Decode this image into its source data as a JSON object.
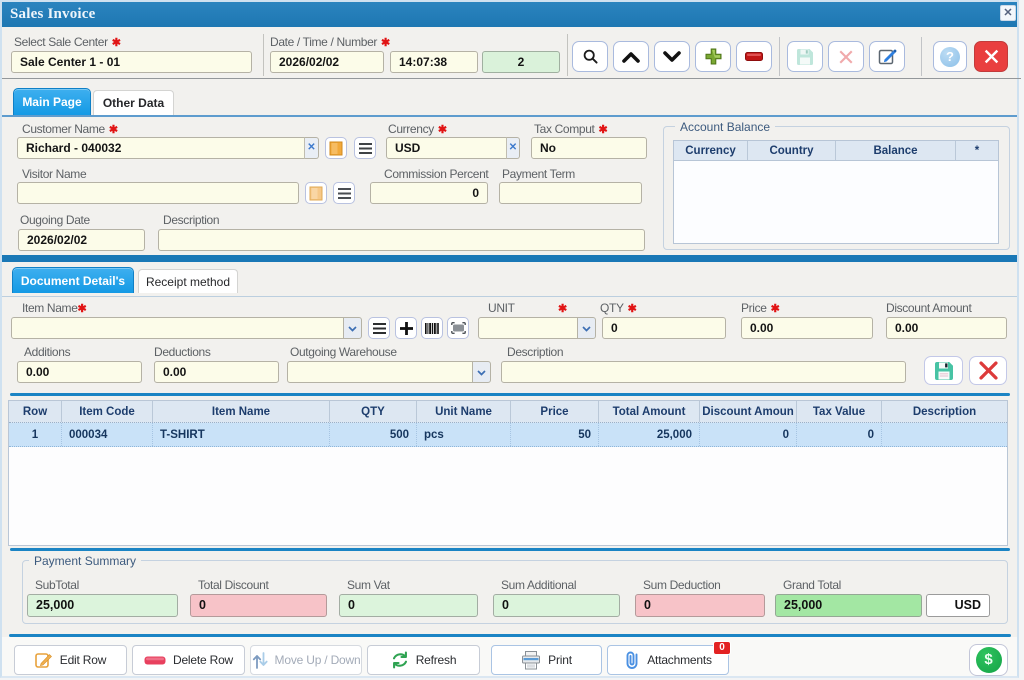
{
  "ui": {
    "required_marker": "✱",
    "clear_x": "✕",
    "titlebar_close_x": "✕",
    "help_q": "?",
    "dollar": "$"
  },
  "window": {
    "title": "Sales Invoice"
  },
  "header": {
    "sale_center_label": "Select Sale Center",
    "sale_center_value": "Sale Center 1 - 01",
    "date_time_number_label": "Date / Time / Number",
    "date_value": "2026/02/02",
    "time_value": "14:07:38",
    "number_value": "2"
  },
  "tabs1": {
    "main_page": "Main Page",
    "other_data": "Other Data"
  },
  "form": {
    "customer_label": "Customer Name",
    "customer_value": "Richard - 040032",
    "currency_label": "Currency",
    "currency_value": "USD",
    "tax_comput_label": "Tax Comput",
    "tax_comput_value": "No",
    "visitor_label": "Visitor Name",
    "visitor_value": "",
    "commission_label": "Commission Percent",
    "commission_value": "0",
    "payment_term_label": "Payment Term",
    "payment_term_value": "",
    "outgoing_date_label": "Ougoing Date",
    "outgoing_date_value": "2026/02/02",
    "description_label": "Description",
    "description_value": ""
  },
  "account_balance": {
    "legend": "Account Balance",
    "columns": [
      "Currency",
      "Country",
      "Balance",
      "*"
    ]
  },
  "tabs2": {
    "document_details": "Document Detail's",
    "receipt_method": "Receipt method"
  },
  "entry": {
    "item_name_label": "Item Name",
    "item_name_value": "",
    "unit_label": "UNIT",
    "unit_value": "",
    "qty_label": "QTY",
    "qty_value": "0",
    "price_label": "Price",
    "price_value": "0.00",
    "discount_label": "Discount Amount",
    "discount_value": "0.00",
    "additions_label": "Additions",
    "additions_value": "0.00",
    "deductions_label": "Deductions",
    "deductions_value": "0.00",
    "warehouse_label": "Outgoing Warehouse",
    "warehouse_value": "",
    "description_label": "Description",
    "description_value": ""
  },
  "grid": {
    "columns": [
      "Row",
      "Item Code",
      "Item Name",
      "QTY",
      "Unit Name",
      "Price",
      "Total Amount",
      "Discount Amoun",
      "Tax Value",
      "Description"
    ],
    "rows": [
      [
        "1",
        "000034",
        "T-SHIRT",
        "500",
        "pcs",
        "50",
        "25,000",
        "0",
        "0",
        ""
      ]
    ]
  },
  "payment": {
    "legend": "Payment Summary",
    "subtotal_label": "SubTotal",
    "subtotal_value": "25,000",
    "total_discount_label": "Total Discount",
    "total_discount_value": "0",
    "sum_vat_label": "Sum Vat",
    "sum_vat_value": "0",
    "sum_additional_label": "Sum Additional",
    "sum_additional_value": "0",
    "sum_deduction_label": "Sum Deduction",
    "sum_deduction_value": "0",
    "grand_total_label": "Grand Total",
    "grand_total_value": "25,000",
    "currency_value": "USD"
  },
  "actions": {
    "edit_row": "Edit Row",
    "delete_row": "Delete Row",
    "move_up_down": "Move Up / Down",
    "refresh": "Refresh",
    "print": "Print",
    "attachments": "Attachments",
    "attachments_badge": "0"
  }
}
